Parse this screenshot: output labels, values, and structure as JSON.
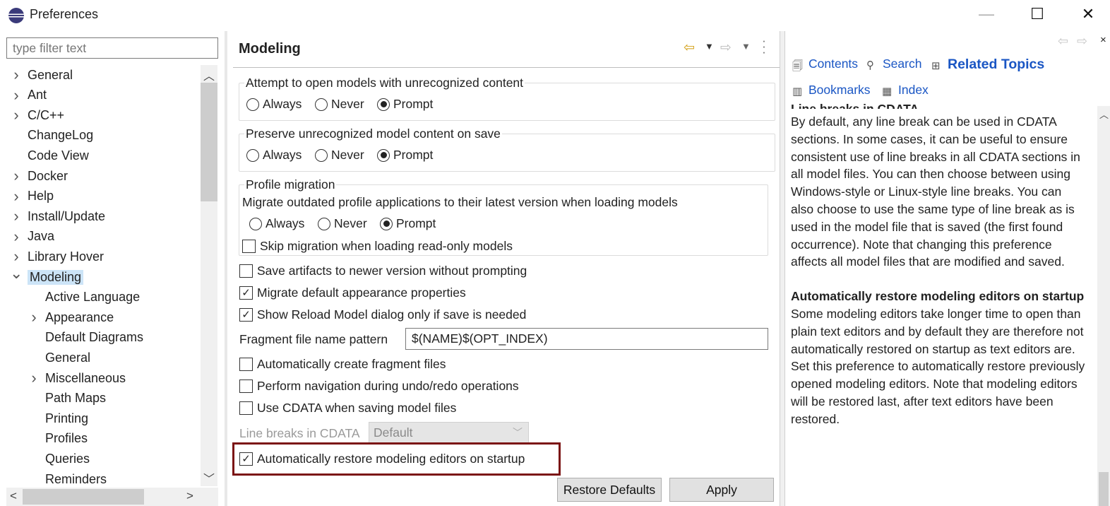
{
  "window": {
    "title": "Preferences",
    "minimize": "—",
    "maximize": "☐",
    "close": "✕"
  },
  "filter": {
    "placeholder": "type filter text"
  },
  "tree": [
    {
      "label": "General",
      "indent": 0,
      "expander": ">"
    },
    {
      "label": "Ant",
      "indent": 0,
      "expander": ">"
    },
    {
      "label": "C/C++",
      "indent": 0,
      "expander": ">"
    },
    {
      "label": "ChangeLog",
      "indent": 0,
      "expander": ""
    },
    {
      "label": "Code View",
      "indent": 0,
      "expander": ""
    },
    {
      "label": "Docker",
      "indent": 0,
      "expander": ">"
    },
    {
      "label": "Help",
      "indent": 0,
      "expander": ">"
    },
    {
      "label": "Install/Update",
      "indent": 0,
      "expander": ">"
    },
    {
      "label": "Java",
      "indent": 0,
      "expander": ">"
    },
    {
      "label": "Library Hover",
      "indent": 0,
      "expander": ">"
    },
    {
      "label": "Modeling",
      "indent": 0,
      "expander": "v",
      "selected": true
    },
    {
      "label": "Active Language",
      "indent": 1,
      "expander": ""
    },
    {
      "label": "Appearance",
      "indent": 1,
      "expander": ">"
    },
    {
      "label": "Default Diagrams",
      "indent": 1,
      "expander": ""
    },
    {
      "label": "General",
      "indent": 1,
      "expander": ""
    },
    {
      "label": "Miscellaneous",
      "indent": 1,
      "expander": ">"
    },
    {
      "label": "Path Maps",
      "indent": 1,
      "expander": ""
    },
    {
      "label": "Printing",
      "indent": 1,
      "expander": ""
    },
    {
      "label": "Profiles",
      "indent": 1,
      "expander": ""
    },
    {
      "label": "Queries",
      "indent": 1,
      "expander": ""
    },
    {
      "label": "Reminders",
      "indent": 1,
      "expander": ""
    }
  ],
  "page": {
    "title": "Modeling",
    "group_open": {
      "label": "Attempt to open models with unrecognized content",
      "options": [
        "Always",
        "Never",
        "Prompt"
      ],
      "selected": "Prompt"
    },
    "group_preserve": {
      "label": "Preserve unrecognized model content on save",
      "options": [
        "Always",
        "Never",
        "Prompt"
      ],
      "selected": "Prompt"
    },
    "group_profile": {
      "label": "Profile migration",
      "description": "Migrate outdated profile applications to their latest version when loading models",
      "options": [
        "Always",
        "Never",
        "Prompt"
      ],
      "selected": "Prompt",
      "skip_label": "Skip migration when loading read-only models",
      "skip_checked": false
    },
    "checks": [
      {
        "label": "Save artifacts to newer version without prompting",
        "checked": false
      },
      {
        "label": "Migrate default appearance properties",
        "checked": true
      },
      {
        "label": "Show Reload Model dialog only if save is needed",
        "checked": true
      }
    ],
    "fragment": {
      "label": "Fragment file name pattern",
      "value": "$(NAME)$(OPT_INDEX)"
    },
    "checks2": [
      {
        "label": "Automatically create fragment files",
        "checked": false
      },
      {
        "label": "Perform navigation during undo/redo operations",
        "checked": false
      },
      {
        "label": "Use CDATA when saving model files",
        "checked": false
      }
    ],
    "line_breaks": {
      "label": "Line breaks in CDATA",
      "value": "Default"
    },
    "restore_editors": {
      "label": "Automatically restore modeling editors on startup",
      "checked": true
    },
    "buttons": {
      "restore_defaults": "Restore Defaults",
      "apply": "Apply"
    }
  },
  "help": {
    "tabs": {
      "contents": "Contents",
      "search": "Search",
      "related": "Related Topics",
      "bookmarks": "Bookmarks",
      "index": "Index"
    },
    "cut_heading": "Line breaks in CDATA",
    "para1": "By default, any line break can be used in CDATA sections. In some cases, it can be useful to ensure consistent use of line breaks in all CDATA sections in all model files. You can then choose between using Windows-style or Linux-style line breaks. You can also choose to use the same type of line break as is used in the model file that is saved (the first found occurrence). Note that changing this preference affects all model files that are modified and saved.",
    "heading2": "Automatically restore modeling editors on startup",
    "para2": "Some modeling editors take longer time to open than plain text editors and by default they are therefore not automatically restored on startup as text editors are. Set this preference to automatically restore previously opened modeling editors. Note that modeling editors will be restored last, after text editors have been restored."
  },
  "colors": {
    "accent_highlight": "#7b1414",
    "selection": "#cce4f7",
    "link": "#1a56c4"
  }
}
